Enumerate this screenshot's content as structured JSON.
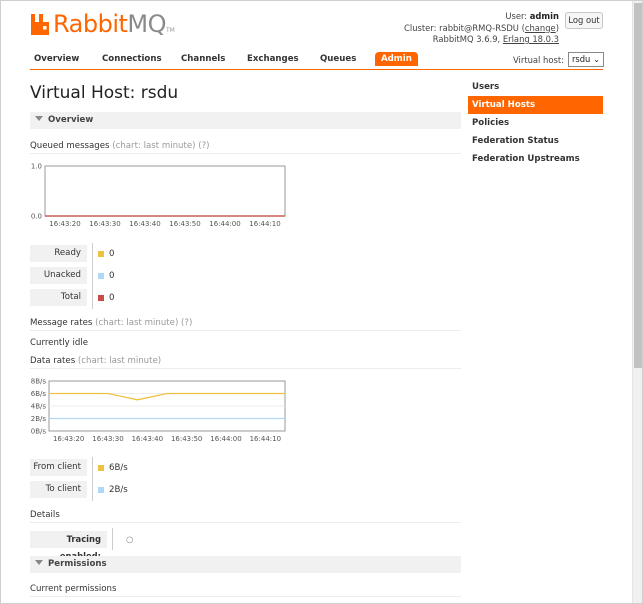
{
  "header": {
    "brand_rabbit": "Rabbit",
    "brand_mq": "MQ",
    "brand_tm": "TM",
    "user_label": "User:",
    "user_name": "admin",
    "cluster_label": "Cluster:",
    "cluster_name": "rabbit@RMQ-RSDU",
    "change_open": "(",
    "change_link": "change",
    "change_close": ")",
    "version_text": "RabbitMQ 3.6.9,",
    "erlang_link": "Erlang 18.0.3",
    "logout_label": "Log out"
  },
  "nav": {
    "tabs": [
      {
        "label": "Overview"
      },
      {
        "label": "Connections"
      },
      {
        "label": "Channels"
      },
      {
        "label": "Exchanges"
      },
      {
        "label": "Queues"
      },
      {
        "label": "Admin"
      }
    ],
    "vhost_label": "Virtual host:",
    "vhost_value": "rsdu"
  },
  "page": {
    "title_prefix": "Virtual Host:",
    "title_name": "rsdu"
  },
  "overview": {
    "section_label": "Overview",
    "queued_title": "Queued messages",
    "queued_suffix": "(chart: last minute) (?)",
    "queued_legend": [
      {
        "label": "Ready",
        "value": "0",
        "color": "#edc240"
      },
      {
        "label": "Unacked",
        "value": "0",
        "color": "#afd8f8"
      },
      {
        "label": "Total",
        "value": "0",
        "color": "#cb4b4b"
      }
    ],
    "rates_title": "Message rates",
    "rates_suffix": "(chart: last minute) (?)",
    "currently_idle": "Currently idle",
    "data_title": "Data rates",
    "data_suffix": "(chart: last minute)",
    "data_legend": [
      {
        "label": "From client",
        "value": "6B/s",
        "color": "#edc240"
      },
      {
        "label": "To client",
        "value": "2B/s",
        "color": "#afd8f8"
      }
    ],
    "details_title": "Details",
    "tracing_label": "Tracing enabled:",
    "tracing_value": "○"
  },
  "permissions": {
    "section_label": "Permissions",
    "current_title": "Current permissions"
  },
  "sidebar": {
    "items": [
      {
        "label": "Users"
      },
      {
        "label": "Virtual Hosts"
      },
      {
        "label": "Policies"
      },
      {
        "label": "Federation Status"
      },
      {
        "label": "Federation Upstreams"
      }
    ]
  },
  "chart_data": [
    {
      "type": "line",
      "x": [
        "16:43:20",
        "16:43:30",
        "16:43:40",
        "16:43:50",
        "16:44:00",
        "16:44:10"
      ],
      "ytick_labels": [
        "1.0",
        "0.0"
      ],
      "ylim": [
        0,
        1
      ],
      "series": [
        {
          "name": "Ready",
          "values": [
            0,
            0,
            0,
            0,
            0,
            0
          ],
          "color": "#edc240"
        },
        {
          "name": "Unacked",
          "values": [
            0,
            0,
            0,
            0,
            0,
            0
          ],
          "color": "#afd8f8"
        },
        {
          "name": "Total",
          "values": [
            0,
            0,
            0,
            0,
            0,
            0
          ],
          "color": "#cb4b4b"
        }
      ]
    },
    {
      "type": "line",
      "x": [
        "16:43:10",
        "16:43:20",
        "16:43:25",
        "16:43:30",
        "16:43:35",
        "16:43:40",
        "16:43:50",
        "16:44:00",
        "16:44:10"
      ],
      "x_tick_labels": [
        "16:43:20",
        "16:43:30",
        "16:43:40",
        "16:43:50",
        "16:44:00",
        "16:44:10"
      ],
      "ytick_labels": [
        "8B/s",
        "6B/s",
        "4B/s",
        "2B/s",
        "0B/s"
      ],
      "ylim": [
        0,
        8
      ],
      "series": [
        {
          "name": "From client",
          "values": [
            6,
            6,
            6,
            5,
            6,
            6,
            6,
            6,
            6
          ],
          "color": "#edc240"
        },
        {
          "name": "To client",
          "values": [
            2,
            2,
            2,
            2,
            2,
            2,
            2,
            2,
            2
          ],
          "color": "#afd8f8"
        }
      ]
    }
  ]
}
